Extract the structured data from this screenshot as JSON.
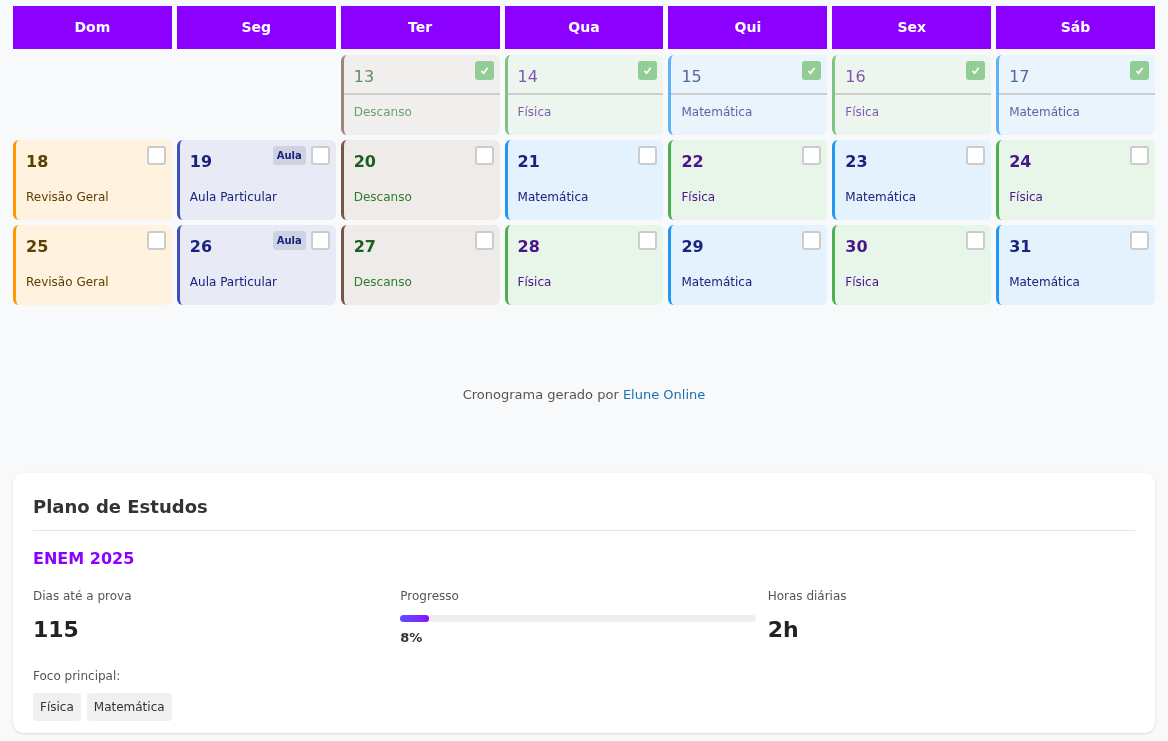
{
  "weekdays": [
    "Dom",
    "Seg",
    "Ter",
    "Qua",
    "Qui",
    "Sex",
    "Sáb"
  ],
  "weeks": [
    [
      {
        "kind": "empty"
      },
      {
        "kind": "empty"
      },
      {
        "day": "13",
        "subject": "Descanso",
        "kind": "rest",
        "checked": true
      },
      {
        "day": "14",
        "subject": "Física",
        "kind": "physics",
        "checked": true
      },
      {
        "day": "15",
        "subject": "Matemática",
        "kind": "math",
        "checked": true
      },
      {
        "day": "16",
        "subject": "Física",
        "kind": "physics",
        "checked": true
      },
      {
        "day": "17",
        "subject": "Matemática",
        "kind": "math",
        "checked": true
      }
    ],
    [
      {
        "day": "18",
        "subject": "Revisão Geral",
        "kind": "review",
        "checked": false
      },
      {
        "day": "19",
        "subject": "Aula Particular",
        "kind": "lesson",
        "badge": "Aula",
        "checked": false
      },
      {
        "day": "20",
        "subject": "Descanso",
        "kind": "rest",
        "checked": false
      },
      {
        "day": "21",
        "subject": "Matemática",
        "kind": "math",
        "checked": false
      },
      {
        "day": "22",
        "subject": "Física",
        "kind": "physics",
        "checked": false
      },
      {
        "day": "23",
        "subject": "Matemática",
        "kind": "math",
        "checked": false
      },
      {
        "day": "24",
        "subject": "Física",
        "kind": "physics",
        "checked": false
      }
    ],
    [
      {
        "day": "25",
        "subject": "Revisão Geral",
        "kind": "review",
        "checked": false
      },
      {
        "day": "26",
        "subject": "Aula Particular",
        "kind": "lesson",
        "badge": "Aula",
        "checked": false
      },
      {
        "day": "27",
        "subject": "Descanso",
        "kind": "rest",
        "checked": false
      },
      {
        "day": "28",
        "subject": "Física",
        "kind": "physics",
        "checked": false
      },
      {
        "day": "29",
        "subject": "Matemática",
        "kind": "math",
        "checked": false
      },
      {
        "day": "30",
        "subject": "Física",
        "kind": "physics",
        "checked": false
      },
      {
        "day": "31",
        "subject": "Matemática",
        "kind": "math",
        "checked": false
      }
    ]
  ],
  "footer": {
    "text": "Cronograma gerado por",
    "link": "Elune Online"
  },
  "plan": {
    "title": "Plano de Estudos",
    "exam": "ENEM 2025",
    "stats": [
      {
        "label": "Dias até a prova",
        "value": "115",
        "kind": "number"
      },
      {
        "label": "Progresso",
        "value": "8%",
        "kind": "progress",
        "level": 0.08
      },
      {
        "label": "Horas diárias",
        "value": "2h",
        "kind": "number"
      }
    ],
    "focus_label": "Foco principal:",
    "focus_tags": [
      "Física",
      "Matemática"
    ]
  }
}
